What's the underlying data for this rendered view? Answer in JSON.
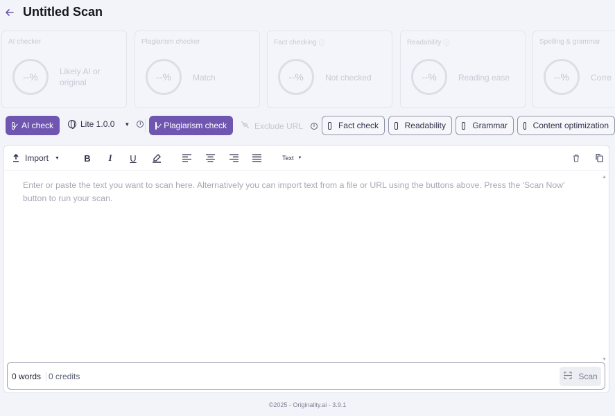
{
  "header": {
    "title": "Untitled Scan",
    "back_icon": "arrow-left-icon"
  },
  "cards": [
    {
      "label": "AI checker",
      "value": "--%",
      "desc_line1": "Likely AI or",
      "desc_line2": "original"
    },
    {
      "label": "Plagiarism checker",
      "value": "--%",
      "desc_line1": "Match"
    },
    {
      "label": "Fact checking",
      "value": "--%",
      "desc_line1": "Not checked"
    },
    {
      "label": "Readability",
      "value": "--%",
      "desc_line1": "Reading ease"
    },
    {
      "label": "Spelling & grammar",
      "value": "--%",
      "desc_line1": "Corre"
    }
  ],
  "options": {
    "ai_check": "AI check",
    "model": "Lite 1.0.0",
    "plagiarism_check": "Plagiarism check",
    "exclude_url": "Exclude URL",
    "fact_check": "Fact check",
    "readability": "Readability",
    "grammar": "Grammar",
    "content_optimization": "Content optimization"
  },
  "toolbar": {
    "import_label": "Import",
    "bold": "B",
    "italic": "I",
    "underline": "U",
    "text_style": "Text"
  },
  "editor": {
    "placeholder": "Enter or paste the text you want to scan here. Alternatively you can import text from a file or URL using the buttons above. Press the 'Scan Now' button to run your scan."
  },
  "status": {
    "words": "0 words",
    "credits": "0 credits",
    "scan_label": "Scan"
  },
  "footer": {
    "text": "©2025 - Originality.ai - 3.9.1"
  },
  "colors": {
    "accent": "#6f56b0",
    "background": "#f3f4f9"
  }
}
